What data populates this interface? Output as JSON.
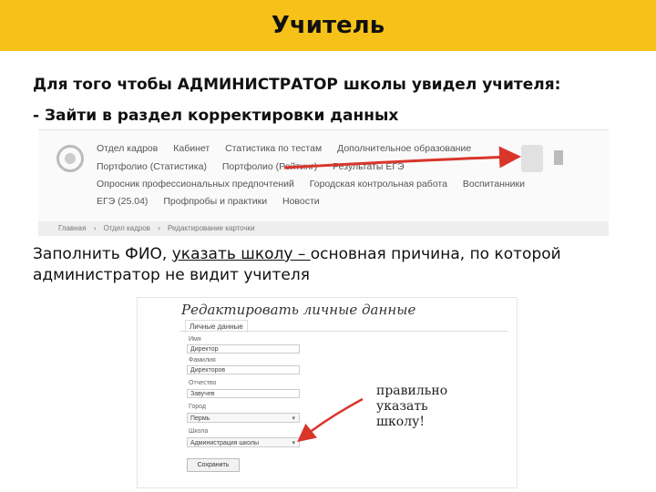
{
  "title": "Учитель",
  "intro": "Для того чтобы АДМИНИСТРАТОР школы увидел учителя:",
  "step": "- Зайти в раздел корректировки данных",
  "screenshot1": {
    "menu_rows": [
      [
        "Отдел кадров",
        "Кабинет",
        "Статистика по тестам",
        "Дополнительное образование"
      ],
      [
        "Портфолио (Статистика)",
        "Портфолио (Рейтинг)",
        "Результаты ЕГЭ"
      ],
      [
        "Опросник профессиональных предпочтений",
        "Городская контрольная работа",
        "Воспитанники"
      ],
      [
        "ЕГЭ (25.04)",
        "Профпробы и практики",
        "Новости"
      ]
    ],
    "breadcrumbs": [
      "Главная",
      "›",
      "Отдел кадров",
      "›",
      "Редактирование карточки"
    ]
  },
  "paragraph": {
    "part1": "Заполнить ФИО, ",
    "underlined": "указать школу – ",
    "part2": "основная причина, по которой администратор не видит учителя"
  },
  "screenshot2": {
    "heading": "Редактировать личные данные",
    "tab": "Личные данные",
    "fields": [
      {
        "label": "Имя",
        "value": "Директор"
      },
      {
        "label": "Фамилия",
        "value": "Директоров"
      },
      {
        "label": "Отчество",
        "value": "Завучев"
      }
    ],
    "selects": [
      {
        "label": "Город",
        "value": "Пермь"
      },
      {
        "label": "Школа",
        "value": "Администрация школы"
      }
    ],
    "save_label": "Сохранить",
    "handwritten_note": [
      "правильно",
      "указать",
      "школу!"
    ]
  },
  "colors": {
    "title_bar": "#f6c21a",
    "arrow": "#d9352b"
  }
}
